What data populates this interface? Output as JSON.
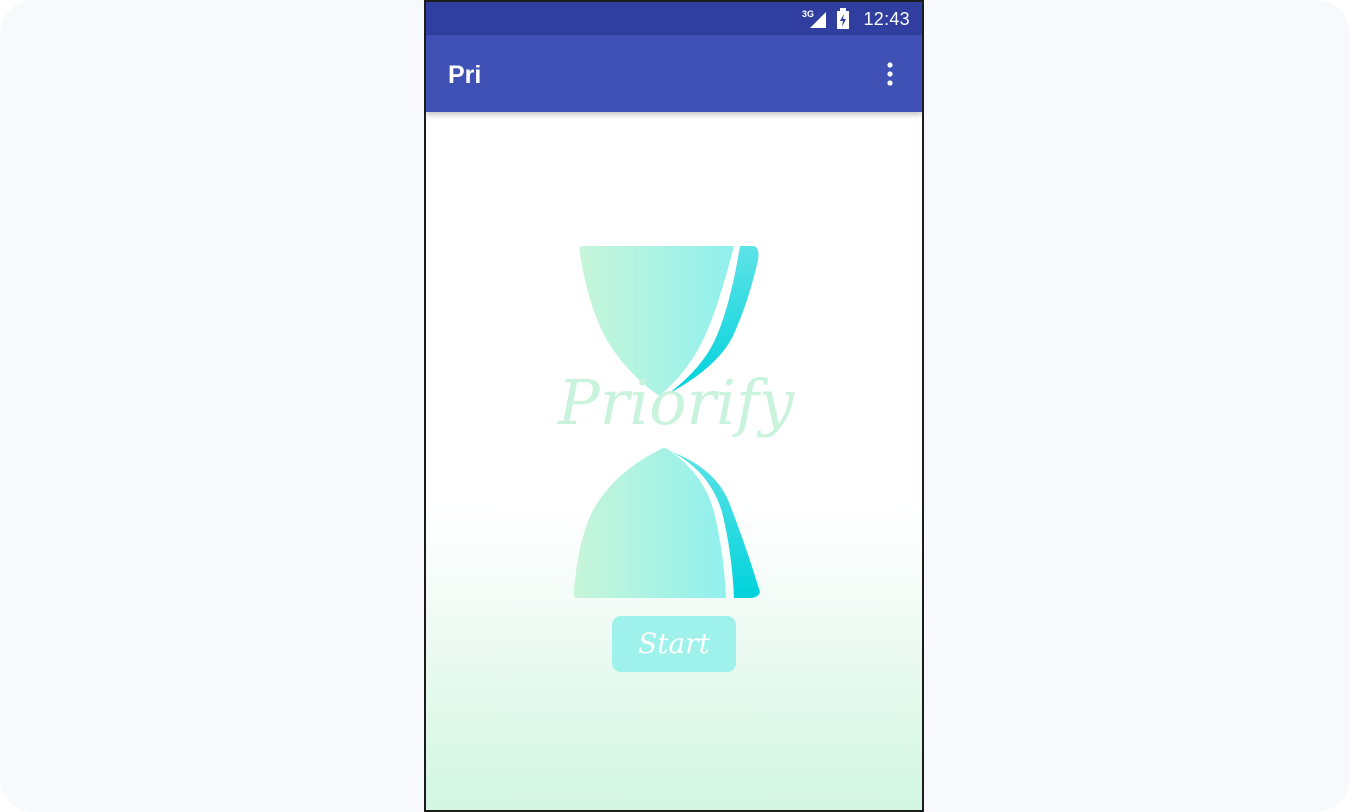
{
  "status_bar": {
    "time": "12:43",
    "network_label": "3G",
    "signal_icon": "signal-icon",
    "battery_icon": "battery-charging-icon"
  },
  "app_bar": {
    "title": "Pri",
    "menu_icon": "more-vert-icon"
  },
  "main": {
    "logo_text": "Priorify",
    "start_label": "Start"
  },
  "colors": {
    "status_bar": "#303f9f",
    "app_bar": "#3f51b5",
    "logo_mint": "#c9f3dc",
    "logo_cyan": "#00d2dc",
    "button": "#9ff1eb"
  }
}
